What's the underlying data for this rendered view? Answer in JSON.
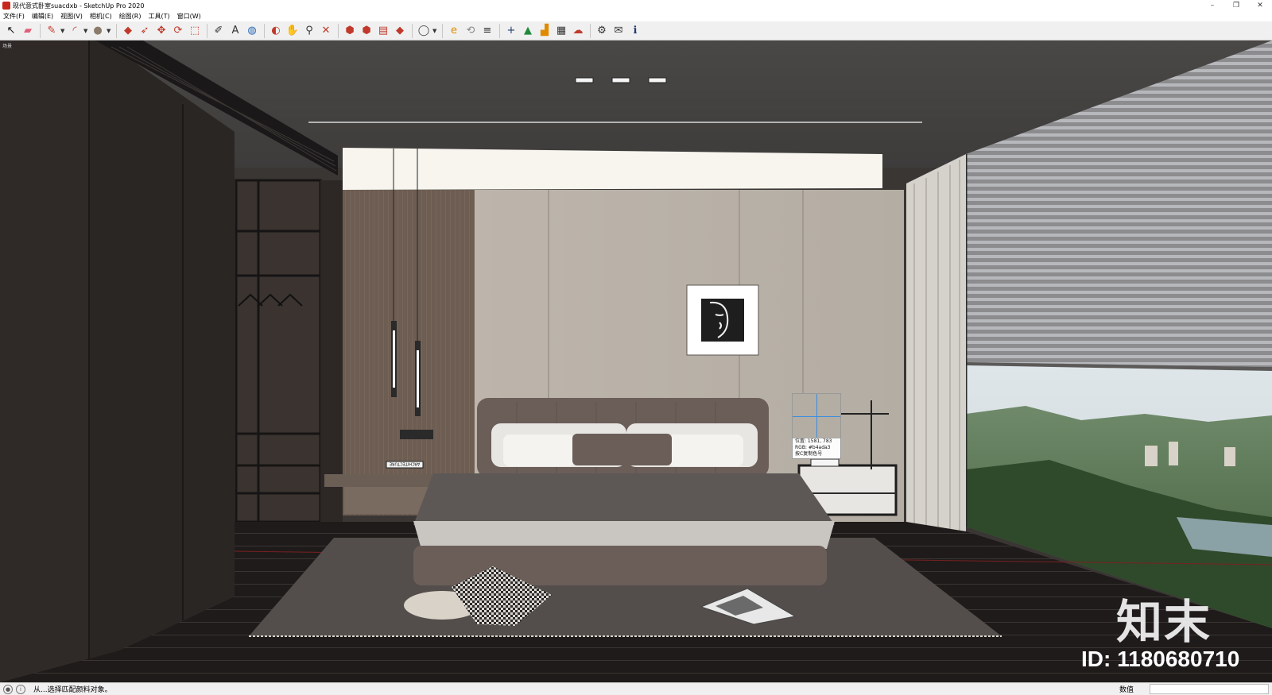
{
  "window": {
    "title": "现代意式卧室suacdxb - SketchUp Pro 2020",
    "minimize": "–",
    "maximize": "❐",
    "close": "✕"
  },
  "menu": [
    "文件(F)",
    "编辑(E)",
    "视图(V)",
    "相机(C)",
    "绘图(R)",
    "工具(T)",
    "窗口(W)"
  ],
  "toolbar_icons": [
    {
      "name": "select-icon",
      "glyph": "↖",
      "color": "#111111"
    },
    {
      "name": "eraser-icon",
      "glyph": "▰",
      "color": "#e0607a"
    },
    {
      "name": "pencil-icon",
      "glyph": "✎",
      "color": "#c0392b"
    },
    {
      "name": "arc-icon",
      "glyph": "◜",
      "color": "#c0392b"
    },
    {
      "name": "shapes-icon",
      "glyph": "●",
      "color": "#8a7b6a"
    },
    {
      "name": "push-pull-icon",
      "glyph": "◆",
      "color": "#c0392b"
    },
    {
      "name": "follow-me-icon",
      "glyph": "➶",
      "color": "#c0392b"
    },
    {
      "name": "move-icon",
      "glyph": "✥",
      "color": "#c0392b"
    },
    {
      "name": "rotate-icon",
      "glyph": "⟳",
      "color": "#c0392b"
    },
    {
      "name": "scale-icon",
      "glyph": "⬚",
      "color": "#c0392b"
    },
    {
      "name": "tape-measure-icon",
      "glyph": "✐",
      "color": "#333333"
    },
    {
      "name": "text-icon",
      "glyph": "A",
      "color": "#333333"
    },
    {
      "name": "paint-bucket-icon",
      "glyph": "◍",
      "color": "#2a6ab5"
    },
    {
      "name": "orbit-icon",
      "glyph": "◐",
      "color": "#c0392b"
    },
    {
      "name": "pan-icon",
      "glyph": "✋",
      "color": "#333333"
    },
    {
      "name": "zoom-icon",
      "glyph": "⚲",
      "color": "#333333"
    },
    {
      "name": "zoom-extents-icon",
      "glyph": "✕",
      "color": "#c0392b"
    },
    {
      "name": "warehouse-icon",
      "glyph": "⬢",
      "color": "#c0392b"
    },
    {
      "name": "extension-warehouse-icon",
      "glyph": "⬢",
      "color": "#c0392b"
    },
    {
      "name": "layout-icon",
      "glyph": "▤",
      "color": "#c0392b"
    },
    {
      "name": "ruby-icon",
      "glyph": "◆",
      "color": "#c0392b"
    },
    {
      "name": "account-icon",
      "glyph": "◯",
      "color": "#444444"
    },
    {
      "name": "plugin-e-icon",
      "glyph": "e",
      "color": "#e08a00"
    },
    {
      "name": "sync-icon",
      "glyph": "⟲",
      "color": "#888888"
    },
    {
      "name": "layers-icon",
      "glyph": "≡",
      "color": "#333333"
    },
    {
      "name": "add-icon",
      "glyph": "+",
      "color": "#1e3a6e"
    },
    {
      "name": "tree-icon",
      "glyph": "▲",
      "color": "#1f8a3b"
    },
    {
      "name": "stairs-icon",
      "glyph": "▟",
      "color": "#e08a00"
    },
    {
      "name": "checker-icon",
      "glyph": "▦",
      "color": "#333333"
    },
    {
      "name": "upload-icon",
      "glyph": "☁",
      "color": "#c0392b"
    },
    {
      "name": "settings-icon",
      "glyph": "⚙",
      "color": "#333333"
    },
    {
      "name": "mail-icon",
      "glyph": "✉",
      "color": "#333333"
    },
    {
      "name": "info-icon",
      "glyph": "ℹ",
      "color": "#1e3a6e"
    }
  ],
  "viewport": {
    "label": "场景",
    "color_tooltip": {
      "position_label": "位置: 1581, 783",
      "rgb_label": "RGB: #b4ada3",
      "copy_hint": "按C复制色号"
    },
    "book_label": "ARCHITECTURE",
    "watermark_logo": "知末",
    "watermark_id": "ID: 1180680710"
  },
  "status": {
    "message": "从...选择匹配颜料对象。",
    "measurement_label": "数值",
    "measurement_value": ""
  }
}
